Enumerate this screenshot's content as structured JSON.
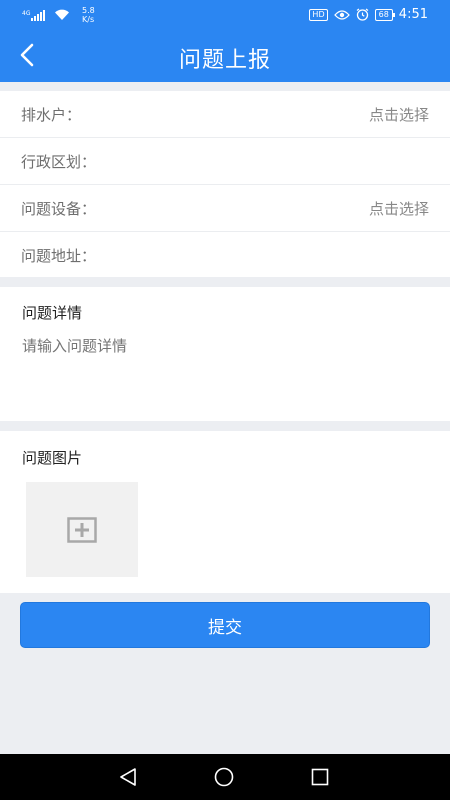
{
  "status_bar": {
    "network_type": "4G",
    "net_speed_value": "5.8",
    "net_speed_unit": "K/s",
    "hd_label": "HD",
    "battery": "68",
    "time": "4:51"
  },
  "header": {
    "title": "问题上报",
    "back_icon": "chevron-left-icon"
  },
  "form": {
    "rows": [
      {
        "label": "排水户：",
        "value": "点击选择"
      },
      {
        "label": "行政区划：",
        "value": ""
      },
      {
        "label": "问题设备：",
        "value": "点击选择"
      },
      {
        "label": "问题地址：",
        "value": ""
      }
    ]
  },
  "detail": {
    "title": "问题详情",
    "placeholder": "请输入问题详情"
  },
  "photos": {
    "title": "问题图片",
    "add_icon": "add-photo-icon"
  },
  "actions": {
    "submit_label": "提交"
  },
  "colors": {
    "primary": "#2B86F2",
    "background": "#ECEEF2",
    "navbar": "#000000"
  }
}
